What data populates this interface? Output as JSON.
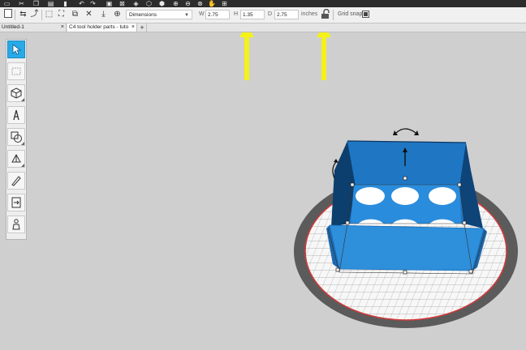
{
  "toolbar": {
    "icons": [
      "new-icon",
      "cut-icon",
      "copy-icon",
      "paste-icon",
      "delete-icon",
      "undo-icon",
      "redo-icon",
      "group-icon",
      "ungroup-icon",
      "3d-box-icon",
      "3d-view-icon",
      "zoom-in-icon",
      "zoom-out-icon",
      "zoom-fit-icon",
      "pan-hand-icon",
      "zoom-box-icon"
    ]
  },
  "options": {
    "dropdown_value": "Dimensions",
    "w_label": "W",
    "w_value": "2.75",
    "h_label": "H",
    "h_value": "1.35",
    "d_label": "D",
    "d_value": "2.75",
    "units": "inches",
    "grid_snap_label": "Grid snap",
    "grid_snap_checked": true
  },
  "tabs": [
    {
      "label": "Untitled-1",
      "close": "×",
      "active": false
    },
    {
      "label": "C4 tool holder parts - tuto",
      "close": "×",
      "active": true
    }
  ],
  "add_tab": "+",
  "tools": [
    "select-tool",
    "node-edit-tool",
    "3d-shape-tool",
    "text-tool",
    "shape-tool",
    "paint-tool",
    "knife-tool",
    "import-tool",
    "figure-tool"
  ],
  "colors": {
    "model": "#2e8fdb",
    "model_dark": "#1b6fb8",
    "annotation_arrows": "#f4f219",
    "accent": "#29a9e8",
    "platform_rim": "#d23a3a"
  }
}
